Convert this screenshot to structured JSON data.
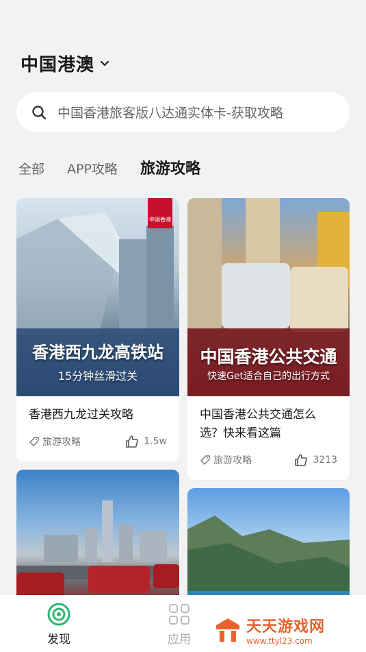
{
  "header": {
    "region": "中国港澳"
  },
  "search": {
    "placeholder": "中国香港旅客版八达通实体卡-获取攻略"
  },
  "tabs": [
    {
      "label": "全部",
      "active": false
    },
    {
      "label": "APP攻略",
      "active": false
    },
    {
      "label": "旅游攻略",
      "active": true
    }
  ],
  "cards": [
    {
      "image_title": "香港西九龙高铁站",
      "image_subtitle": "15分钟丝滑过关",
      "flag_text": "中国香港",
      "title": "香港西九龙过关攻略",
      "tag": "旅游攻略",
      "likes": "1.5w"
    },
    {
      "image_title": "中国香港公共交通",
      "image_subtitle": "快速Get适合自己的出行方式",
      "title": "中国香港公共交通怎么选？快来看这篇",
      "tag": "旅游攻略",
      "likes": "3213"
    }
  ],
  "tabbar": {
    "discover": "发现",
    "apps": "应用"
  },
  "watermark": {
    "main": "天天游戏网",
    "sub": "www.ttyl23.com"
  },
  "colors": {
    "accent_green": "#2bb673",
    "watermark_orange": "#e8632b",
    "background": "#f2f2f2"
  }
}
